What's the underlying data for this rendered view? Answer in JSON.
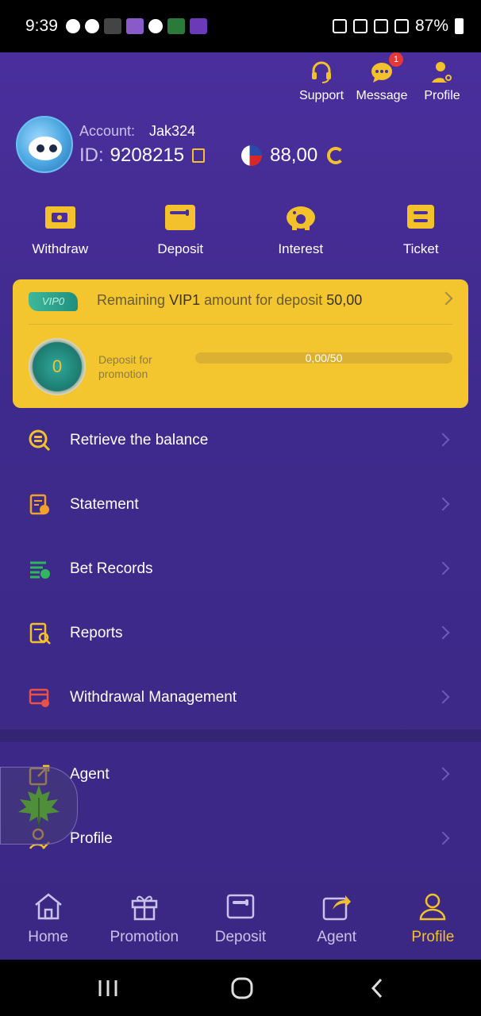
{
  "status_bar": {
    "time": "9:39",
    "battery": "87%"
  },
  "top_nav": {
    "support": "Support",
    "message": "Message",
    "message_badge": "1",
    "profile": "Profile"
  },
  "user": {
    "account_label": "Account:",
    "account_value": "Jak324",
    "id_label": "ID:",
    "id_value": "9208215",
    "balance": "88,00"
  },
  "quick_actions": [
    {
      "label": "Withdraw",
      "icon": "withdraw-icon"
    },
    {
      "label": "Deposit",
      "icon": "wallet-icon"
    },
    {
      "label": "Interest",
      "icon": "piggy-bank-icon"
    },
    {
      "label": "Ticket",
      "icon": "ticket-icon"
    }
  ],
  "vip": {
    "badge": "VIP0",
    "text_prefix": "Remaining",
    "level": "VIP1",
    "text_middle": "amount for deposit",
    "amount": "50,00",
    "medal_value": "0",
    "deposit_label": "Deposit for promotion",
    "progress_text": "0,00/50",
    "progress_fraction": 0
  },
  "menu": [
    {
      "label": "Retrieve the balance",
      "icon": "coin-search-icon",
      "color": "#f3c12b"
    },
    {
      "label": "Statement",
      "icon": "statement-icon",
      "color": "#f3a12b"
    },
    {
      "label": "Bet Records",
      "icon": "bet-records-icon",
      "color": "#2fb85a"
    },
    {
      "label": "Reports",
      "icon": "reports-icon",
      "color": "#f3c12b"
    },
    {
      "label": "Withdrawal Management",
      "icon": "withdrawal-card-icon",
      "color": "#e8504a"
    }
  ],
  "menu2": [
    {
      "label": "Agent",
      "icon": "share-icon"
    },
    {
      "label": "Profile",
      "icon": "user-edit-icon"
    }
  ],
  "bottom_nav": [
    {
      "label": "Home",
      "icon": "home-icon"
    },
    {
      "label": "Promotion",
      "icon": "gift-icon"
    },
    {
      "label": "Deposit",
      "icon": "wallet-icon"
    },
    {
      "label": "Agent",
      "icon": "share-icon"
    },
    {
      "label": "Profile",
      "icon": "user-icon",
      "active": true
    }
  ],
  "colors": {
    "accent": "#f3c12b",
    "background": "#3e2a8c",
    "vip_card": "#f3c52f"
  }
}
